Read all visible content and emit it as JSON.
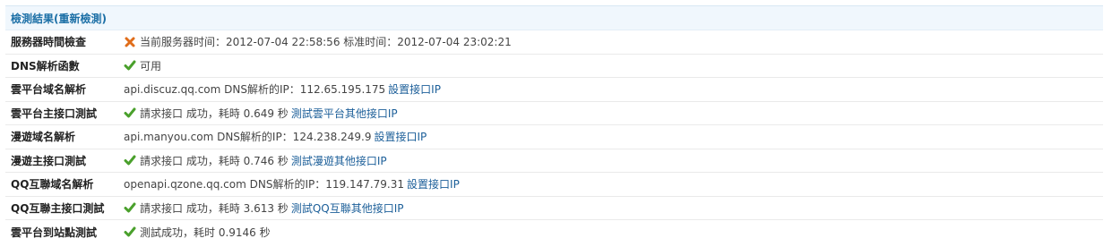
{
  "header": {
    "title": "檢測結果(重新檢測)"
  },
  "colors": {
    "accent": "#1b6fa6",
    "ok": "#4aa02c",
    "error": "#e06d1a",
    "link": "#1c5f99"
  },
  "rows": [
    {
      "label": "服務器時間檢查",
      "status": "error",
      "icon": "x-icon",
      "text": "当前服务器时间：2012-07-04 22:58:56 标准时间：2012-07-04 23:02:21",
      "link": ""
    },
    {
      "label": "DNS解析函數",
      "status": "ok",
      "icon": "check-icon",
      "text": "可用",
      "link": ""
    },
    {
      "label": "雲平台域名解析",
      "status": "none",
      "icon": "",
      "text": "api.discuz.qq.com DNS解析的IP：112.65.195.175",
      "link": "設置接口IP"
    },
    {
      "label": "雲平台主接口測試",
      "status": "ok",
      "icon": "check-icon",
      "text": "請求接口 成功，耗時 0.649 秒",
      "link": "測試雲平台其他接口IP"
    },
    {
      "label": "漫遊域名解析",
      "status": "none",
      "icon": "",
      "text": "api.manyou.com DNS解析的IP：124.238.249.9",
      "link": "設置接口IP"
    },
    {
      "label": "漫遊主接口測試",
      "status": "ok",
      "icon": "check-icon",
      "text": "請求接口 成功，耗時 0.746 秒",
      "link": "測試漫遊其他接口IP"
    },
    {
      "label": "QQ互聯域名解析",
      "status": "none",
      "icon": "",
      "text": "openapi.qzone.qq.com DNS解析的IP：119.147.79.31",
      "link": "設置接口IP"
    },
    {
      "label": "QQ互聯主接口測試",
      "status": "ok",
      "icon": "check-icon",
      "text": "請求接口 成功，耗時 3.613 秒",
      "link": "測試QQ互聯其他接口IP"
    },
    {
      "label": "雲平台到站點測試",
      "status": "ok",
      "icon": "check-icon",
      "text": "測試成功，耗时 0.9146 秒",
      "link": ""
    }
  ]
}
